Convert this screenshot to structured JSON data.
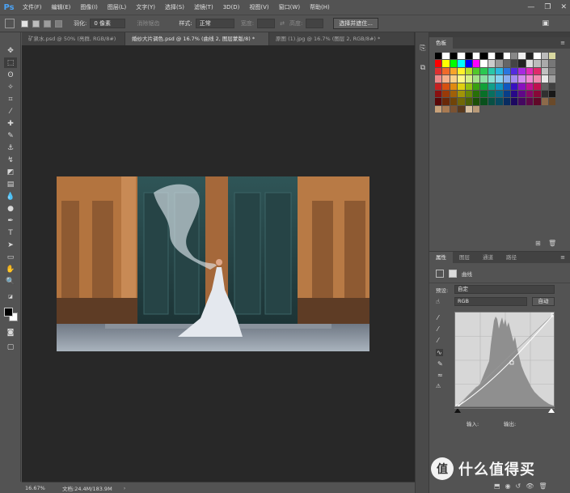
{
  "app": {
    "logo": "Ps",
    "menu": [
      "文件(F)",
      "编辑(E)",
      "图像(I)",
      "图层(L)",
      "文字(Y)",
      "选择(S)",
      "滤镜(T)",
      "3D(D)",
      "视图(V)",
      "窗口(W)",
      "帮助(H)"
    ],
    "window_controls": {
      "minimize": "—",
      "restore": "❐",
      "close": "✕"
    }
  },
  "options_bar": {
    "feather_label": "羽化:",
    "feather_value": "0 像素",
    "antialias_label": "消除锯齿",
    "style_label": "样式:",
    "style_value": "正常",
    "width_label": "宽度:",
    "height_label": "高度:",
    "select_mask_button": "选择并遮住..."
  },
  "tabs": [
    {
      "label": "矿泉水.psd @ 50% (亮群, RGB/8#)",
      "active": false
    },
    {
      "label": "婚纱大片调色.psd @ 16.7% (曲线 2, 图层蒙版/8) *",
      "active": true
    },
    {
      "label": "原图 (1).jpg @ 16.7% (图层 2, RGB/8#) *",
      "active": false
    }
  ],
  "status": {
    "zoom": "16.67%",
    "doc_info": "文档:24.4M/183.9M"
  },
  "swatches_panel": {
    "title": "色板",
    "colors": [
      "#000000",
      "#ffffff",
      "#000000",
      "#ffffff",
      "#000000",
      "#ffffff",
      "#000000",
      "#ffffff",
      "#111111",
      "#ffffff",
      "#888888",
      "#eeeeee",
      "#222222",
      "#ffffff",
      "#bbbbbb",
      "#d9d8a0",
      "#ff0000",
      "#ffff00",
      "#00ff00",
      "#00ffff",
      "#0000ff",
      "#ff00ff",
      "#ffffff",
      "#cccccc",
      "#999999",
      "#666666",
      "#444444",
      "#222222",
      "#dddddd",
      "#bbbbbb",
      "#aaaaaa",
      "#777777",
      "#e03030",
      "#f06a2a",
      "#f7a42a",
      "#fff22a",
      "#b6e02a",
      "#52c82a",
      "#2ac852",
      "#2ac8a8",
      "#2ab6e0",
      "#2a76e0",
      "#522ae0",
      "#a82ae0",
      "#e02ab6",
      "#e02a6a",
      "#c0c0c0",
      "#808080",
      "#f08a8a",
      "#f5b08a",
      "#f9d08a",
      "#fff88a",
      "#d6f08a",
      "#a4e08a",
      "#8ae0a4",
      "#8ae0d2",
      "#8ad2f0",
      "#8aaef0",
      "#a48af0",
      "#d28af0",
      "#f08ad2",
      "#f08aae",
      "#e8e8e8",
      "#a0a0a0",
      "#c62020",
      "#d65010",
      "#e08a10",
      "#e0d010",
      "#92c010",
      "#38a010",
      "#10a038",
      "#10a08a",
      "#1092c0",
      "#1058c0",
      "#3810c0",
      "#8a10c0",
      "#c01092",
      "#c01050",
      "#606060",
      "#404040",
      "#8a1010",
      "#9a3a08",
      "#a06008",
      "#a09408",
      "#688808",
      "#287008",
      "#087028",
      "#087060",
      "#086888",
      "#083e88",
      "#280888",
      "#600888",
      "#880868",
      "#880838",
      "#303030",
      "#181818",
      "#5a0808",
      "#6a2808",
      "#704408",
      "#706808",
      "#4a6008",
      "#1c5008",
      "#08501c",
      "#085044",
      "#084a60",
      "#082c60",
      "#1c0860",
      "#440860",
      "#600848",
      "#600828",
      "#8c6a4a",
      "#6a4a2a",
      "#c8a27a",
      "#a87a52",
      "#7a5232",
      "#5a3a1e",
      "#d8c0a0",
      "#b89a78"
    ],
    "new_icon": "new-swatch-icon",
    "delete_icon": "trash-icon"
  },
  "properties_panel": {
    "tabs": [
      "属性",
      "图层",
      "通道",
      "路径"
    ],
    "adjustment_title": "曲线",
    "preset_label": "预设:",
    "preset_value": "自定",
    "channel_value": "RGB",
    "auto_button": "自动",
    "input_label": "输入:",
    "output_label": "输出:"
  },
  "watermark": {
    "symbol": "值",
    "text": "什么值得买"
  }
}
